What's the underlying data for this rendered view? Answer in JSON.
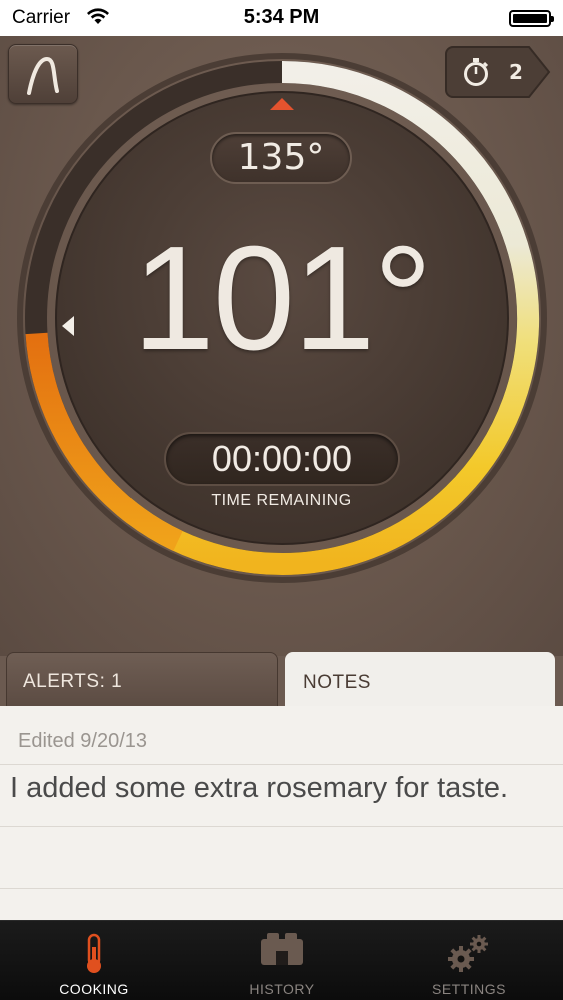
{
  "status_bar": {
    "carrier": "Carrier",
    "time": "5:34 PM"
  },
  "header": {
    "timer_count": "2",
    "logo_icon": "probe-logo-icon",
    "timer_icon": "stopwatch-icon"
  },
  "dial": {
    "target_temp": "135°",
    "current_temp": "101°",
    "time_remaining": "00:00:00",
    "time_remaining_label": "TIME REMAINING",
    "progress_fraction": 0.74
  },
  "tabs": {
    "alerts_label": "ALERTS: 1",
    "notes_label": "NOTES",
    "active": "notes"
  },
  "notes": {
    "edited": "Edited 9/20/13",
    "text": "I added some extra rosemary for taste."
  },
  "tabbar": {
    "items": [
      {
        "label": "COOKING",
        "icon": "thermometer-icon",
        "active": true
      },
      {
        "label": "HISTORY",
        "icon": "history-icon",
        "active": false
      },
      {
        "label": "SETTINGS",
        "icon": "gears-icon",
        "active": false
      }
    ]
  },
  "colors": {
    "background": "#6b5a50",
    "ring_track": "#3a2f29",
    "ring_white": "#e9e6dd",
    "ring_yellow": "#f3c92b",
    "ring_orange": "#e67a12",
    "target_marker": "#e4532e",
    "notes_bg": "#f3f1ed"
  }
}
